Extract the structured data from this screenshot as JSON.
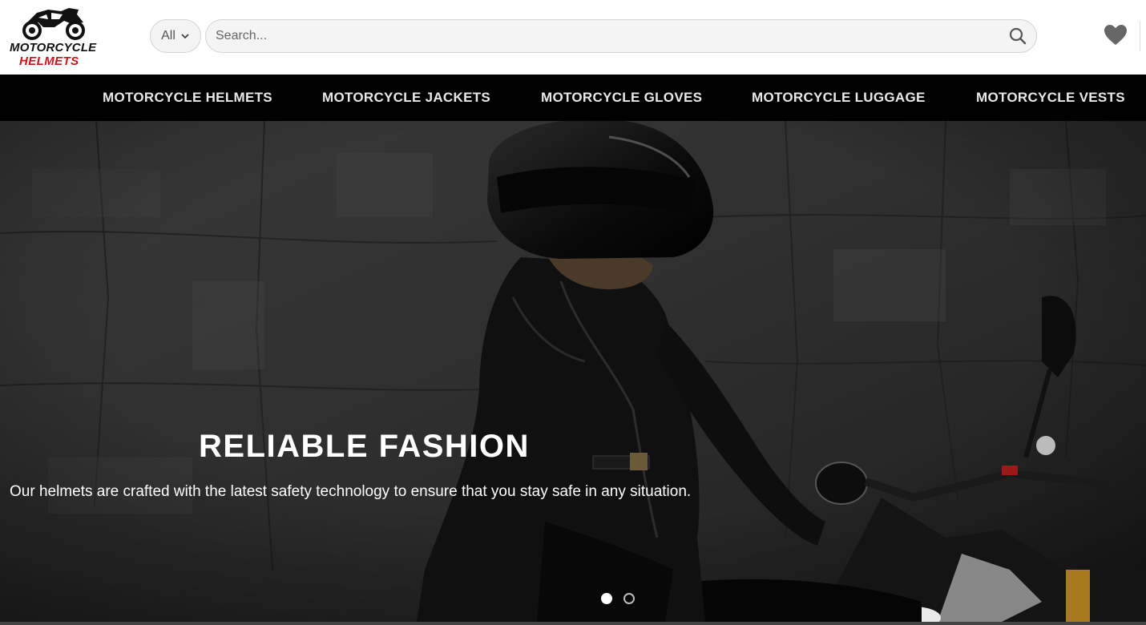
{
  "logo": {
    "line1": "MOTORCYCLE",
    "line2": "HELMETS",
    "icon": "motorcycle-icon",
    "accent": "#d0121b"
  },
  "search": {
    "category_label": "All",
    "placeholder": "Search...",
    "value": ""
  },
  "icons": {
    "category": "chevron-down-icon",
    "search": "search-icon",
    "wishlist": "heart-icon"
  },
  "nav": {
    "items": [
      {
        "label": "MOTORCYCLE HELMETS"
      },
      {
        "label": "MOTORCYCLE JACKETS"
      },
      {
        "label": "MOTORCYCLE GLOVES"
      },
      {
        "label": "MOTORCYCLE LUGGAGE"
      },
      {
        "label": "MOTORCYCLE VESTS"
      }
    ]
  },
  "hero": {
    "title": "RELIABLE FASHION",
    "text": "Our helmets are crafted with the latest safety technology to ensure that you stay safe in any situation.",
    "slides": [
      {
        "active": true
      },
      {
        "active": false
      }
    ]
  },
  "colors": {
    "nav_bg": "#000000",
    "nav_text": "#e9e9e9",
    "hero_text": "#ffffff"
  }
}
